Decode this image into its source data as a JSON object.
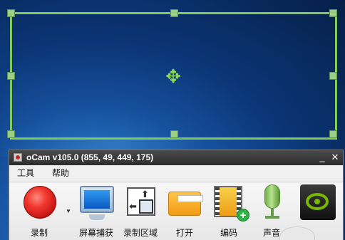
{
  "top_text": "",
  "window": {
    "title": "oCam v105.0 (855, 49, 449, 175)",
    "minimize_label": "_",
    "close_label": "✕"
  },
  "menu": {
    "items": [
      {
        "label": "工具"
      },
      {
        "label": "帮助"
      }
    ]
  },
  "toolbar": {
    "record_label": "录制",
    "screen_capture_label": "屏幕捕获",
    "record_region_label": "录制区域",
    "open_label": "打开",
    "codec_label": "编码",
    "sound_label": "声音"
  },
  "icons": {
    "move": "move-icon",
    "record": "record-icon",
    "screen_capture": "monitor-icon",
    "record_region": "region-icon",
    "open": "folder-icon",
    "codec": "codec-icon",
    "sound": "microphone-icon",
    "nvidia": "nvidia-icon"
  },
  "colors": {
    "capture_border": "#7fca5a",
    "titlebar": "#2d2d2d",
    "record": "#e53935",
    "nvidia": "#76b900"
  }
}
